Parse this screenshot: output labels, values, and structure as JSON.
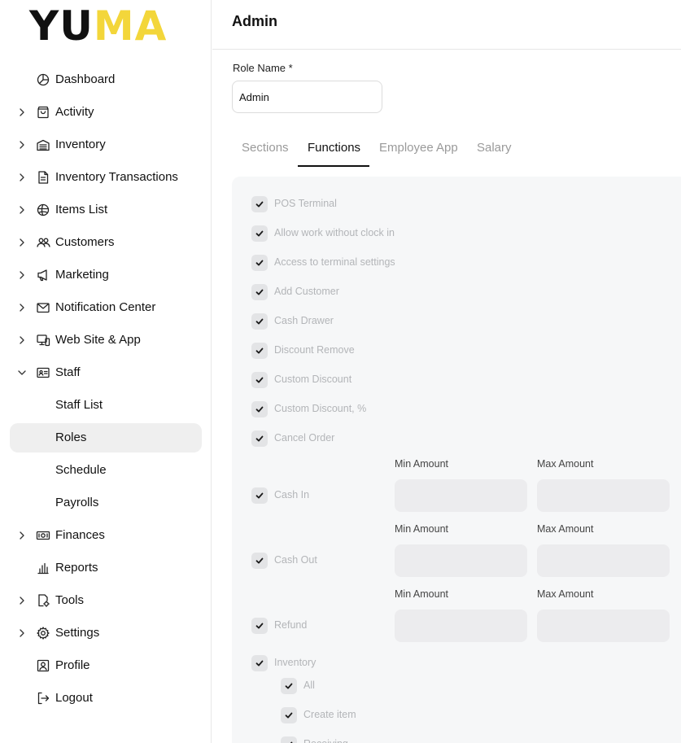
{
  "logo": {
    "part1": "YU",
    "part2": "MA"
  },
  "sidebar": {
    "items": [
      {
        "label": "Dashboard",
        "icon": "dashboard-icon",
        "chevron": false
      },
      {
        "label": "Activity",
        "icon": "activity-icon",
        "chevron": true
      },
      {
        "label": "Inventory",
        "icon": "inventory-icon",
        "chevron": true
      },
      {
        "label": "Inventory Transactions",
        "icon": "document-icon",
        "chevron": true
      },
      {
        "label": "Items List",
        "icon": "items-icon",
        "chevron": true
      },
      {
        "label": "Customers",
        "icon": "customers-icon",
        "chevron": true
      },
      {
        "label": "Marketing",
        "icon": "megaphone-icon",
        "chevron": true
      },
      {
        "label": "Notification Center",
        "icon": "mail-icon",
        "chevron": true
      },
      {
        "label": "Web Site & App",
        "icon": "devices-icon",
        "chevron": true
      },
      {
        "label": "Staff",
        "icon": "id-card-icon",
        "chevron": true,
        "expanded": true
      },
      {
        "label": "Staff List",
        "sub": true
      },
      {
        "label": "Roles",
        "sub": true,
        "active": true
      },
      {
        "label": "Schedule",
        "sub": true
      },
      {
        "label": "Payrolls",
        "sub": true
      },
      {
        "label": "Finances",
        "icon": "money-icon",
        "chevron": true
      },
      {
        "label": "Reports",
        "icon": "reports-icon",
        "chevron": false
      },
      {
        "label": "Tools",
        "icon": "tools-icon",
        "chevron": true
      },
      {
        "label": "Settings",
        "icon": "gear-icon",
        "chevron": true
      },
      {
        "label": "Profile",
        "icon": "profile-icon",
        "chevron": false
      },
      {
        "label": "Logout",
        "icon": "logout-icon",
        "chevron": false
      }
    ]
  },
  "header": {
    "title": "Admin"
  },
  "form": {
    "role_label": "Role Name *",
    "role_value": "Admin"
  },
  "tabs": [
    "Sections",
    "Functions",
    "Employee App",
    "Salary"
  ],
  "active_tab": "Functions",
  "functions": [
    "POS Terminal",
    "Allow work without clock in",
    "Access to terminal settings",
    "Add Customer",
    "Cash Drawer",
    "Discount Remove",
    "Custom Discount",
    "Custom Discount, %",
    "Cancel Order"
  ],
  "amount_functions": [
    {
      "label": "Cash In",
      "min_label": "Min Amount",
      "max_label": "Max Amount"
    },
    {
      "label": "Cash Out",
      "min_label": "Min Amount",
      "max_label": "Max Amount"
    },
    {
      "label": "Refund",
      "min_label": "Min Amount",
      "max_label": "Max Amount"
    }
  ],
  "inventory": {
    "label": "Inventory",
    "children": [
      "All",
      "Create item",
      "Receiving"
    ]
  },
  "colors": {
    "accent": "#f3d63a",
    "active_bg": "#efefef",
    "panel_bg": "#f6f7f8"
  }
}
